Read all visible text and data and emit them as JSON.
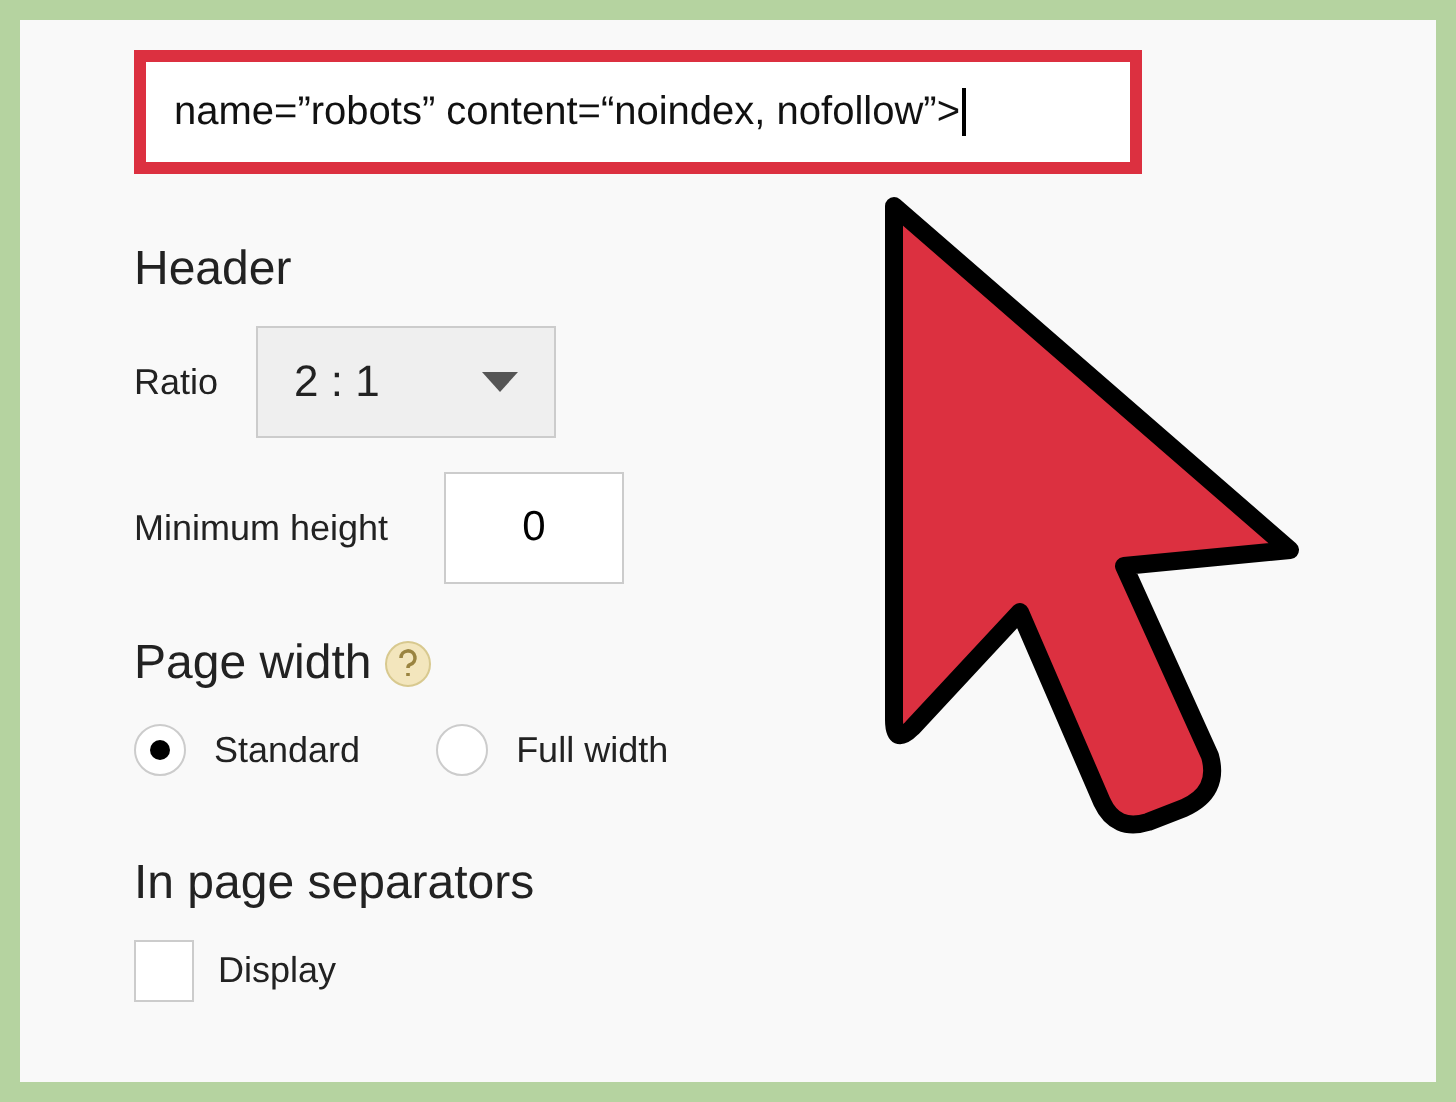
{
  "code_field": {
    "value": "name=”robots” content=“noindex, nofollow”>",
    "highlighted": true
  },
  "header": {
    "title": "Header",
    "ratio": {
      "label": "Ratio",
      "value": "2 : 1"
    },
    "min_height": {
      "label": "Minimum height",
      "value": "0"
    }
  },
  "page_width": {
    "title": "Page width",
    "options": [
      {
        "label": "Standard",
        "selected": true
      },
      {
        "label": "Full width",
        "selected": false
      }
    ]
  },
  "separators": {
    "title": "In page separators",
    "display": {
      "label": "Display",
      "checked": false
    }
  }
}
